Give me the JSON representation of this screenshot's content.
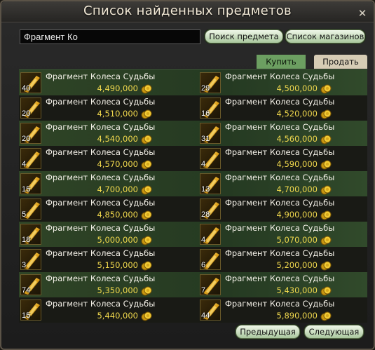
{
  "window": {
    "title": "Список найденных предметов",
    "close_glyph": "✕"
  },
  "search": {
    "value": "Фрагмент Ко",
    "search_button": "Поиск предмета",
    "shops_button": "Список магазинов"
  },
  "tabs": {
    "buy": "Купить",
    "sell": "Продать"
  },
  "pagination": {
    "prev": "Предыдущая",
    "next": "Следующая"
  },
  "icons": {
    "item": "fortune-wheel-fragment-icon",
    "coin": "gold-coin-icon"
  },
  "colors": {
    "price": "#f0d84d",
    "active_tab": "#6c9f61"
  },
  "items": [
    {
      "name": "Фрагмент Колеса Судьбы",
      "qty": "40",
      "price": "4,490,000"
    },
    {
      "name": "Фрагмент Колеса Судьбы",
      "qty": "29",
      "price": "4,500,000"
    },
    {
      "name": "Фрагмент Колеса Судьбы",
      "qty": "20",
      "price": "4,510,000"
    },
    {
      "name": "Фрагмент Колеса Судьбы",
      "qty": "16",
      "price": "4,520,000"
    },
    {
      "name": "Фрагмент Колеса Судьбы",
      "qty": "20",
      "price": "4,540,000"
    },
    {
      "name": "Фрагмент Колеса Судьбы",
      "qty": "31",
      "price": "4,560,000"
    },
    {
      "name": "Фрагмент Колеса Судьбы",
      "qty": "4",
      "price": "4,570,000"
    },
    {
      "name": "Фрагмент Колеса Судьбы",
      "qty": "4",
      "price": "4,590,000"
    },
    {
      "name": "Фрагмент Колеса Судьбы",
      "qty": "15",
      "price": "4,700,000"
    },
    {
      "name": "Фрагмент Колеса Судьбы",
      "qty": "13",
      "price": "4,700,000"
    },
    {
      "name": "Фрагмент Колеса Судьбы",
      "qty": "5",
      "price": "4,850,000"
    },
    {
      "name": "Фрагмент Колеса Судьбы",
      "qty": "28",
      "price": "4,900,000"
    },
    {
      "name": "Фрагмент Колеса Судьбы",
      "qty": "18",
      "price": "5,000,000"
    },
    {
      "name": "Фрагмент Колеса Судьбы",
      "qty": "4",
      "price": "5,070,000"
    },
    {
      "name": "Фрагмент Колеса Судьбы",
      "qty": "3",
      "price": "5,150,000"
    },
    {
      "name": "Фрагмент Колеса Судьбы",
      "qty": "6",
      "price": "5,200,000"
    },
    {
      "name": "Фрагмент Колеса Судьбы",
      "qty": "74",
      "price": "5,350,000"
    },
    {
      "name": "Фрагмент Колеса Судьбы",
      "qty": "7",
      "price": "5,430,000"
    },
    {
      "name": "Фрагмент Колеса Судьбы",
      "qty": "15",
      "price": "5,440,000"
    },
    {
      "name": "Фрагмент Колеса Судьбы",
      "qty": "44",
      "price": "5,890,000"
    }
  ]
}
